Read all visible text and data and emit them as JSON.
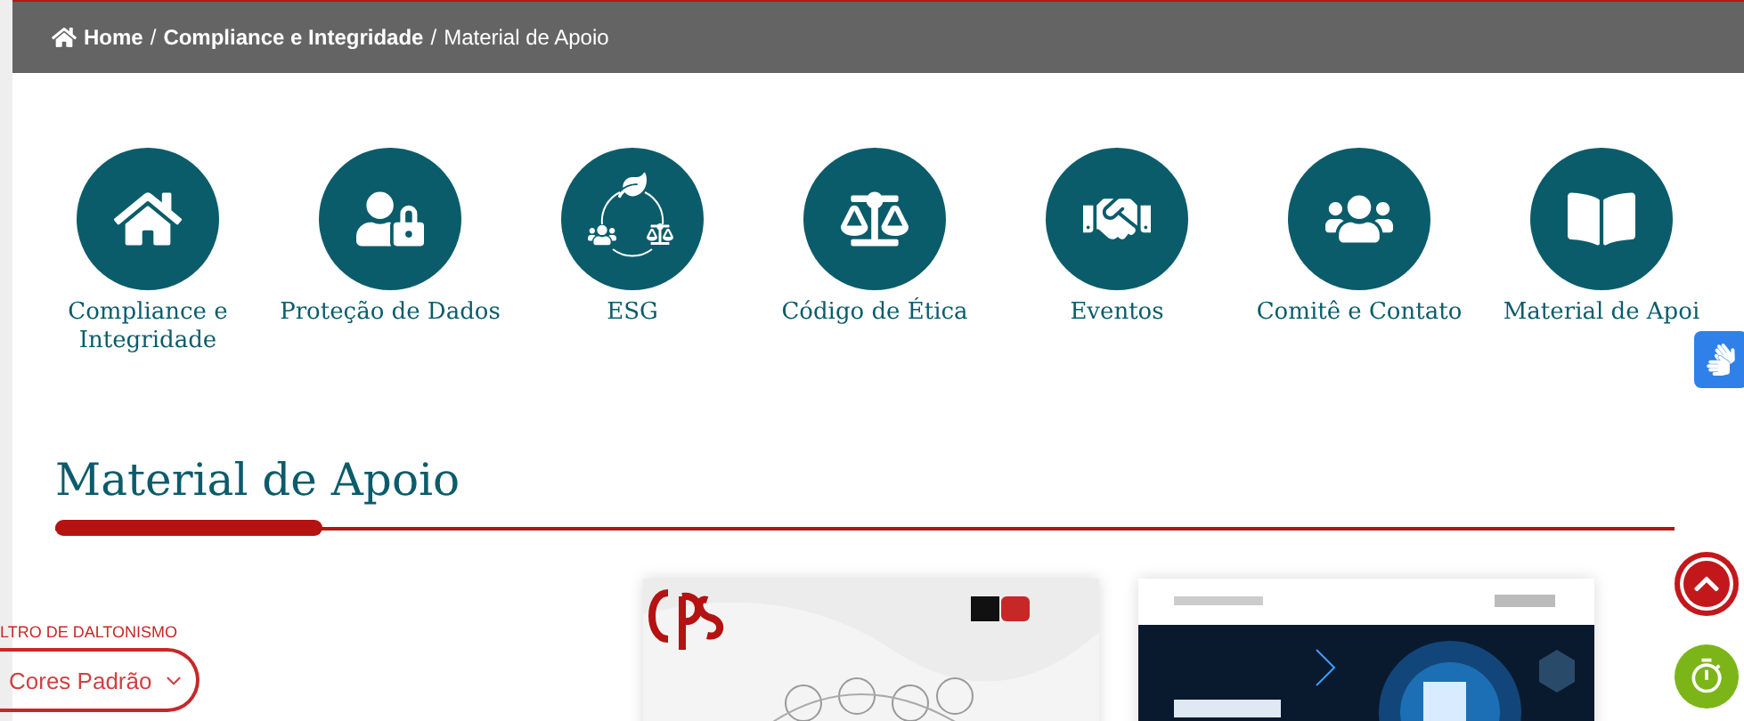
{
  "breadcrumb": [
    {
      "kind": "link",
      "label": "Home"
    },
    {
      "kind": "separator",
      "label": "/"
    },
    {
      "kind": "link",
      "label": "Compliance e Integridade"
    },
    {
      "kind": "separator",
      "label": "/"
    },
    {
      "kind": "current",
      "label": "Material de Apoio"
    }
  ],
  "nav_items": [
    {
      "kind": "home",
      "label": "Compliance e Integridade"
    },
    {
      "kind": "privacy",
      "label": "Proteção de Dados"
    },
    {
      "kind": "esg",
      "label": "ESG"
    },
    {
      "kind": "ethics",
      "label": "Código de Ética"
    },
    {
      "kind": "events",
      "label": "Eventos"
    },
    {
      "kind": "committee",
      "label": "Comitê e Contato"
    },
    {
      "kind": "material",
      "label": "Material de Apoi"
    }
  ],
  "heading": "Material de Apoio",
  "filter": {
    "label": "LTRO DE DALTONISMO",
    "value": "Cores Padrão"
  }
}
